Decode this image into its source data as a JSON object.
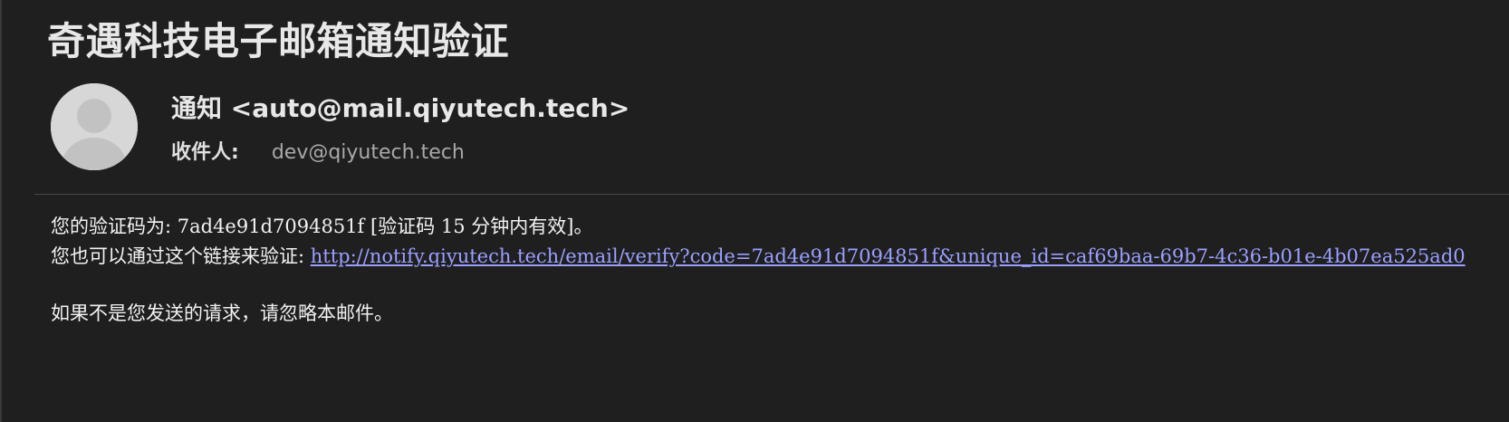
{
  "email": {
    "subject": "奇遇科技电子邮箱通知验证",
    "from": "通知 <auto@mail.qiyutech.tech>",
    "to_label": "收件人:",
    "to_value": "dev@qiyutech.tech",
    "avatar_icon": "user-silhouette-icon"
  },
  "body": {
    "code_line": "您的验证码为: 7ad4e91d7094851f [验证码 15 分钟内有效]。",
    "link_prefix": "您也可以通过这个链接来验证: ",
    "link_text": "http://notify.qiyutech.tech/email/verify?code=7ad4e91d7094851f&unique_id=caf69baa-69b7-4c36-b01e-4b07ea525ad0",
    "ignore_line": "如果不是您发送的请求，请忽略本邮件。"
  },
  "colors": {
    "background": "#1f1f1f",
    "link": "#9aa0ff",
    "avatar": "#d7d7d7"
  }
}
